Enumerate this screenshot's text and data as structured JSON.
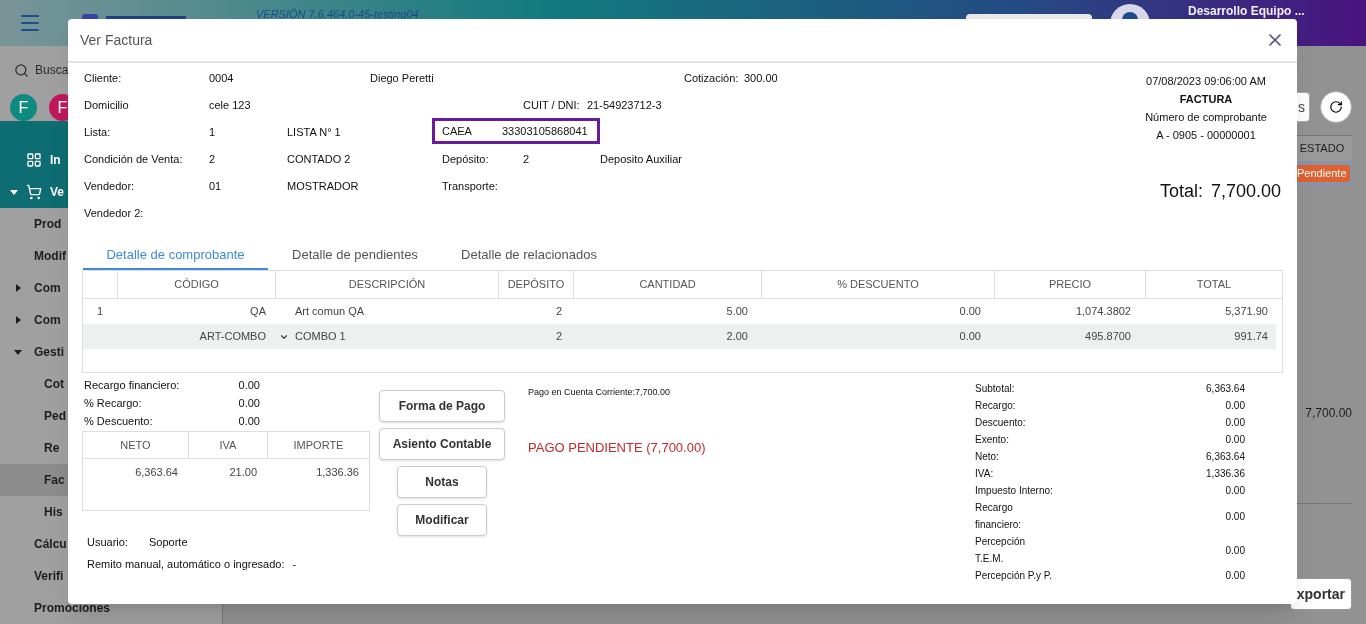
{
  "app": {
    "version": "VERSIÓN 7.6.464.0-45-testing04",
    "user": "Desarrollo Equipo ...",
    "search": {
      "placeholder": "Busca"
    },
    "avatars": [
      {
        "letter": "F",
        "color": "#0f8a80"
      },
      {
        "letter": "F",
        "color": "#c2185b"
      }
    ],
    "sidebar": [
      {
        "label": "In",
        "kind": "top",
        "expanded": false
      },
      {
        "label": "Ve",
        "kind": "top",
        "expanded": true
      },
      {
        "label": "Prod",
        "kind": "item",
        "selected": false
      },
      {
        "label": "Modif",
        "kind": "item",
        "selected": false
      },
      {
        "label": "Com",
        "kind": "group",
        "expanded": false,
        "selected": false
      },
      {
        "label": "Com",
        "kind": "group",
        "expanded": false,
        "selected": false
      },
      {
        "label": "Gesti",
        "kind": "group",
        "expanded": true,
        "selected": false
      },
      {
        "label": "Cot",
        "kind": "sub",
        "selected": false
      },
      {
        "label": "Ped",
        "kind": "sub",
        "selected": false
      },
      {
        "label": "Re",
        "kind": "sub",
        "selected": false
      },
      {
        "label": "Fac",
        "kind": "sub",
        "selected": true
      },
      {
        "label": "His",
        "kind": "sub",
        "selected": false
      },
      {
        "label": "Cálcu",
        "kind": "item",
        "selected": false
      },
      {
        "label": "Verifi",
        "kind": "item",
        "selected": false
      },
      {
        "label": "Promociones",
        "kind": "item",
        "selected": false
      }
    ],
    "columns_button": "s",
    "estado_header": "ESTADO",
    "status_badge": {
      "label": "Pendiente",
      "color": "#e0612f"
    },
    "row_total": "7,700.00",
    "export_button": "xportar"
  },
  "dialog": {
    "title": "Ver Factura",
    "info": {
      "cliente": {
        "label": "Cliente:",
        "code": "0004",
        "name": "Diego Peretti"
      },
      "cotizacion": {
        "label": "Cotización:",
        "value": "300.00"
      },
      "domicilio": {
        "label": "Domicilio",
        "value": "cele 123"
      },
      "cuit": {
        "label": "CUIT / DNI:",
        "value": "21-54923712-3"
      },
      "lista": {
        "label": "Lista:",
        "code": "1",
        "name": "LISTA N° 1"
      },
      "caea": {
        "label": "CAEA",
        "value": "33303105868041"
      },
      "condicion": {
        "label": "Condición de Venta:",
        "code": "2",
        "name": "CONTADO 2"
      },
      "deposito": {
        "label": "Depósito:",
        "code": "2",
        "name": "Deposito Auxiliar"
      },
      "vendedor": {
        "label": "Vendedor:",
        "code": "01",
        "name": "MOSTRADOR"
      },
      "transporte": {
        "label": "Transporte:"
      },
      "vendedor2": {
        "label": "Vendedor 2:"
      }
    },
    "doc": {
      "date": "07/08/2023 09:06:00 AM",
      "type": "FACTURA",
      "number_label": "Número de comprobante",
      "number": "A - 0905 - 00000001",
      "total_label": "Total:",
      "total": "7,700.00"
    },
    "tabs": [
      {
        "label": "Detalle de comprobante",
        "selected": true
      },
      {
        "label": "Detalle de pendientes",
        "selected": false
      },
      {
        "label": "Detalle de relacionados",
        "selected": false
      }
    ],
    "table": {
      "columns": [
        "CÓDIGO",
        "DESCRIPCIÓN",
        "DEPÓSITO",
        "CANTIDAD",
        "% DESCUENTO",
        "PRECIO",
        "TOTAL"
      ],
      "rows": [
        {
          "kind": "item",
          "selected": false,
          "index": "1",
          "code": "QA",
          "description": "Art comun QA",
          "deposit": "2",
          "quantity": "5.00",
          "discount": "0.00",
          "price": "1,074.3802",
          "total": "5,371.90"
        },
        {
          "kind": "combo",
          "selected": true,
          "code": "ART-COMBO",
          "description": "COMBO 1",
          "deposit": "2",
          "quantity": "2.00",
          "discount": "0.00",
          "price": "495.8700",
          "total": "991.74"
        }
      ]
    },
    "adjustments": [
      {
        "label": "Recargo financiero:",
        "value": "0.00"
      },
      {
        "label": "% Recargo:",
        "value": "0.00"
      },
      {
        "label": "% Descuento:",
        "value": "0.00"
      }
    ],
    "tax_table": {
      "columns": [
        "NETO",
        "IVA",
        "IMPORTE"
      ],
      "rows": [
        [
          "6,363.64",
          "21.00",
          "1,336.36"
        ]
      ]
    },
    "user": {
      "label": "Usuario:",
      "value": "Soporte"
    },
    "remito": {
      "label": "Remito manual, automático o ingresado:",
      "value": "-"
    },
    "buttons": [
      "Forma de Pago",
      "Asiento Contable",
      "Notas",
      "Modificar"
    ],
    "payment_note": "Pago en Cuenta Corriente:7,700.00",
    "payment_status": "PAGO PENDIENTE (7,700.00)",
    "totals": [
      {
        "label": "Subtotal:",
        "value": "6,363.64"
      },
      {
        "label": "Recargo:",
        "value": "0.00"
      },
      {
        "label": "Descuento:",
        "value": "0.00"
      },
      {
        "label": "Exento:",
        "value": "0.00"
      },
      {
        "label": "Neto:",
        "value": "6,363.64"
      },
      {
        "label": "IVA:",
        "value": "1,336.36"
      },
      {
        "label": "Impuesto Interno:",
        "value": "0.00"
      },
      {
        "label": "Recargo financiero:",
        "value": "0.00"
      },
      {
        "label": "Percepción T.E.M.",
        "value": "0.00"
      },
      {
        "label": "Percepción P.y P.",
        "value": "0.00"
      }
    ]
  }
}
